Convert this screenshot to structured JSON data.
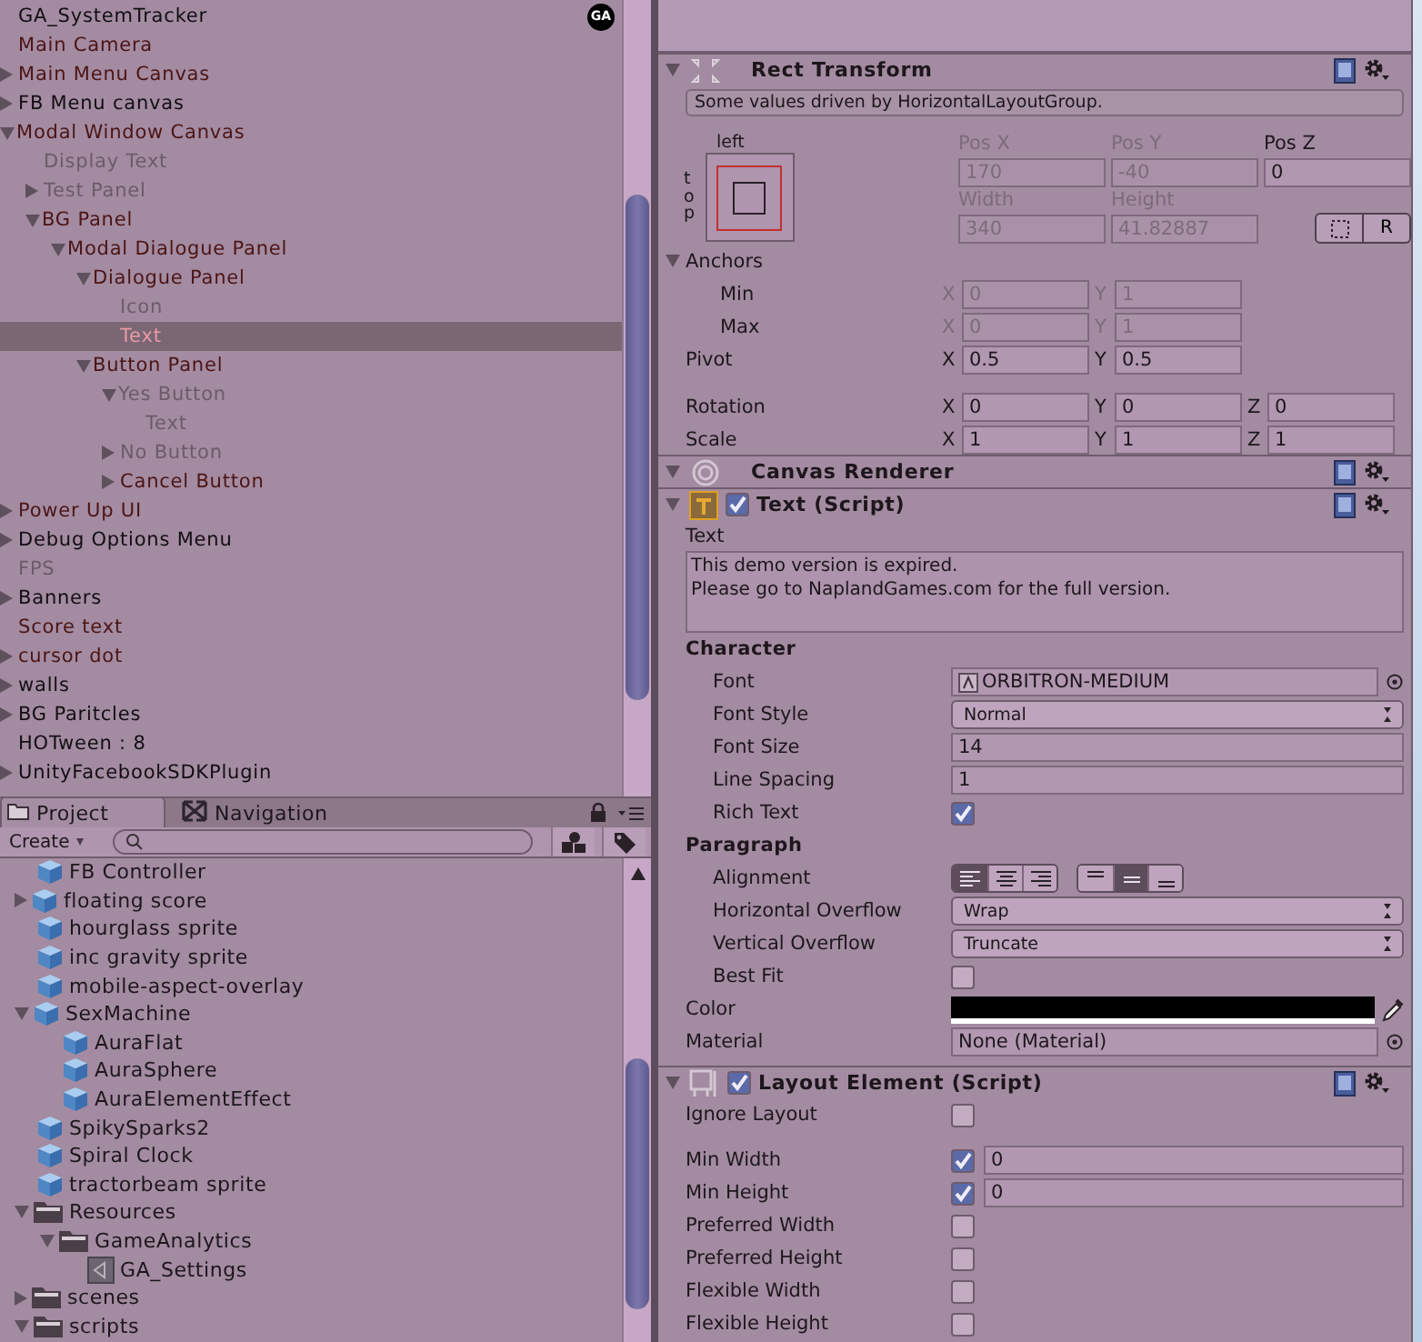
{
  "hierarchy": {
    "items": [
      {
        "label": "GA_SystemTracker",
        "kind": "plain",
        "selected": false,
        "badge": "GA"
      },
      {
        "label": "Main Camera",
        "kind": "prefab",
        "selected": false
      },
      {
        "label": "Main Menu Canvas",
        "kind": "prefab",
        "selected": false,
        "expanded": false
      },
      {
        "label": "FB Menu canvas",
        "kind": "plain",
        "selected": false,
        "expanded": false
      },
      {
        "label": "Modal Window Canvas",
        "kind": "prefab",
        "selected": false,
        "expanded": true,
        "children": [
          {
            "label": "Display Text",
            "kind": "inactive",
            "selected": false
          },
          {
            "label": "Test Panel",
            "kind": "inactive",
            "selected": false,
            "expanded": false
          },
          {
            "label": "BG Panel",
            "kind": "prefab",
            "selected": false,
            "expanded": true,
            "children": [
              {
                "label": "Modal Dialogue Panel",
                "kind": "prefab",
                "selected": false,
                "expanded": true,
                "children": [
                  {
                    "label": "Dialogue Panel",
                    "kind": "prefab",
                    "selected": false,
                    "expanded": true,
                    "children": [
                      {
                        "label": "Icon",
                        "kind": "inactive",
                        "selected": false
                      },
                      {
                        "label": "Text",
                        "kind": "inactive",
                        "selected": true
                      }
                    ]
                  },
                  {
                    "label": "Button Panel",
                    "kind": "prefab",
                    "selected": false,
                    "expanded": true,
                    "children": [
                      {
                        "label": "Yes Button",
                        "kind": "inactive",
                        "selected": false,
                        "expanded": true,
                        "children": [
                          {
                            "label": "Text",
                            "kind": "inactive",
                            "selected": false
                          }
                        ]
                      },
                      {
                        "label": "No Button",
                        "kind": "inactive",
                        "selected": false,
                        "expanded": false
                      },
                      {
                        "label": "Cancel Button",
                        "kind": "prefab",
                        "selected": false,
                        "expanded": false
                      }
                    ]
                  }
                ]
              }
            ]
          }
        ]
      },
      {
        "label": "Power Up UI",
        "kind": "prefab",
        "selected": false,
        "expanded": false
      },
      {
        "label": "Debug Options Menu",
        "kind": "plain",
        "selected": false,
        "expanded": false
      },
      {
        "label": "FPS",
        "kind": "inactive",
        "selected": false
      },
      {
        "label": "Banners",
        "kind": "plain",
        "selected": false,
        "expanded": false
      },
      {
        "label": "Score text",
        "kind": "prefab",
        "selected": false
      },
      {
        "label": "cursor dot",
        "kind": "prefab",
        "selected": false,
        "expanded": false
      },
      {
        "label": "walls",
        "kind": "plain",
        "selected": false,
        "expanded": false
      },
      {
        "label": "BG Paritcles",
        "kind": "plain",
        "selected": false,
        "expanded": false
      },
      {
        "label": "HOTween : 8",
        "kind": "plain",
        "selected": false
      },
      {
        "label": "UnityFacebookSDKPlugin",
        "kind": "plain",
        "selected": false,
        "expanded": false
      }
    ]
  },
  "project": {
    "tabs": [
      {
        "label": "Project",
        "selected": true
      },
      {
        "label": "Navigation",
        "selected": false
      }
    ],
    "create_button": "Create",
    "items": [
      {
        "label": "FB Controller",
        "kind": "prefab"
      },
      {
        "label": "floating score",
        "kind": "prefab",
        "expanded": false
      },
      {
        "label": "hourglass sprite",
        "kind": "prefab"
      },
      {
        "label": "inc gravity sprite",
        "kind": "prefab"
      },
      {
        "label": "mobile-aspect-overlay",
        "kind": "prefab"
      },
      {
        "label": "SexMachine",
        "kind": "prefab",
        "expanded": true,
        "children": [
          {
            "label": "AuraFlat",
            "kind": "prefab"
          },
          {
            "label": "AuraSphere",
            "kind": "prefab"
          },
          {
            "label": "AuraElementEffect",
            "kind": "prefab"
          }
        ]
      },
      {
        "label": "SpikySparks2",
        "kind": "prefab"
      },
      {
        "label": "Spiral Clock",
        "kind": "prefab"
      },
      {
        "label": "tractorbeam sprite",
        "kind": "prefab"
      },
      {
        "label": "Resources",
        "kind": "folder",
        "expanded": true,
        "children": [
          {
            "label": "GameAnalytics",
            "kind": "folder",
            "expanded": true,
            "children": [
              {
                "label": "GA_Settings",
                "kind": "asset"
              }
            ]
          }
        ]
      },
      {
        "label": "scenes",
        "kind": "folder",
        "expanded": false
      },
      {
        "label": "scripts",
        "kind": "folder",
        "expanded": true
      }
    ]
  },
  "inspector": {
    "rect_transform": {
      "title": "Rect Transform",
      "note": "Some values driven by HorizontalLayoutGroup.",
      "preset_h": "left",
      "preset_v": "top",
      "position": [
        {
          "label": "Pos X",
          "value": "170",
          "disabled": true
        },
        {
          "label": "Pos Y",
          "value": "-40",
          "disabled": true
        },
        {
          "label": "Pos Z",
          "value": "0",
          "disabled": false
        }
      ],
      "size": [
        {
          "label": "Width",
          "value": "340",
          "disabled": true
        },
        {
          "label": "Height",
          "value": "41.82887",
          "disabled": true
        }
      ],
      "raw_button": "R",
      "anchors": {
        "label": "Anchors",
        "expanded": true,
        "rows": [
          {
            "label": "Min",
            "disabled": true,
            "fields": [
              {
                "axis": "X",
                "value": "0"
              },
              {
                "axis": "Y",
                "value": "1"
              }
            ]
          },
          {
            "label": "Max",
            "disabled": true,
            "fields": [
              {
                "axis": "X",
                "value": "0"
              },
              {
                "axis": "Y",
                "value": "1"
              }
            ]
          }
        ]
      },
      "pivot": {
        "label": "Pivot",
        "disabled": false,
        "fields": [
          {
            "axis": "X",
            "value": "0.5"
          },
          {
            "axis": "Y",
            "value": "0.5"
          }
        ]
      },
      "transform_rows": [
        {
          "label": "Rotation",
          "disabled": false,
          "fields": [
            {
              "axis": "X",
              "value": "0"
            },
            {
              "axis": "Y",
              "value": "0"
            },
            {
              "axis": "Z",
              "value": "0"
            }
          ]
        },
        {
          "label": "Scale",
          "disabled": false,
          "fields": [
            {
              "axis": "X",
              "value": "1"
            },
            {
              "axis": "Y",
              "value": "1"
            },
            {
              "axis": "Z",
              "value": "1"
            }
          ]
        }
      ]
    },
    "canvas_renderer": {
      "title": "Canvas Renderer"
    },
    "text_script": {
      "title": "Text (Script)",
      "enabled": true,
      "properties": [
        {
          "kind": "textarea",
          "label": "Text",
          "value": "This demo version is expired.\nPlease go to NaplandGames.com for the full version."
        },
        {
          "kind": "header",
          "label": "Character",
          "children": [
            {
              "kind": "object",
              "label": "Font",
              "value": "ORBITRON-MEDIUM"
            },
            {
              "kind": "dropdown",
              "label": "Font Style",
              "value": "Normal"
            },
            {
              "kind": "input",
              "label": "Font Size",
              "value": "14"
            },
            {
              "kind": "input",
              "label": "Line Spacing",
              "value": "1"
            },
            {
              "kind": "checkbox",
              "label": "Rich Text",
              "checked": true
            }
          ]
        },
        {
          "kind": "header",
          "label": "Paragraph",
          "children": [
            {
              "kind": "alignment",
              "label": "Alignment",
              "horizontal": [
                {
                  "selected": true
                },
                {
                  "selected": false
                },
                {
                  "selected": false
                }
              ],
              "vertical": [
                {
                  "selected": false
                },
                {
                  "selected": true
                },
                {
                  "selected": false
                }
              ]
            },
            {
              "kind": "dropdown",
              "label": "Horizontal Overflow",
              "value": "Wrap"
            },
            {
              "kind": "dropdown",
              "label": "Vertical Overflow",
              "value": "Truncate"
            },
            {
              "kind": "checkbox",
              "label": "Best Fit",
              "checked": false
            }
          ]
        },
        {
          "kind": "color",
          "label": "Color",
          "color": "#000000"
        },
        {
          "kind": "object",
          "label": "Material",
          "value": "None (Material)"
        }
      ]
    },
    "layout_element": {
      "title": "Layout Element (Script)",
      "enabled": true,
      "properties": [
        {
          "kind": "checkbox",
          "label": "Ignore Layout",
          "checked": false
        },
        {
          "kind": "toggle_input",
          "label": "Min Width",
          "checked": true,
          "value": "0"
        },
        {
          "kind": "toggle_input",
          "label": "Min Height",
          "checked": true,
          "value": "0"
        },
        {
          "kind": "toggle_input",
          "label": "Preferred Width",
          "checked": false
        },
        {
          "kind": "toggle_input",
          "label": "Preferred Height",
          "checked": false
        },
        {
          "kind": "toggle_input",
          "label": "Flexible Width",
          "checked": false
        },
        {
          "kind": "toggle_input",
          "label": "Flexible Height",
          "checked": false
        }
      ]
    }
  }
}
